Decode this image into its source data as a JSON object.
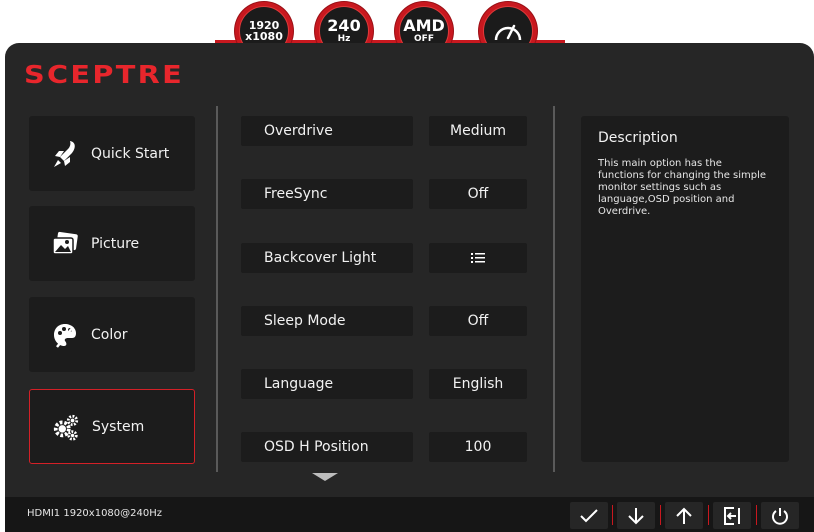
{
  "brand": {
    "logo": "SCEPTRE"
  },
  "badges": [
    {
      "line1": "1920",
      "line2": "x1080"
    },
    {
      "line1": "240",
      "line2": "Hz"
    },
    {
      "line1": "AMD",
      "line2": "OFF"
    },
    {
      "icon": "speedometer-icon"
    }
  ],
  "menu": [
    {
      "label": "Quick Start",
      "icon": "rocket-icon"
    },
    {
      "label": "Picture",
      "icon": "pictures-icon"
    },
    {
      "label": "Color",
      "icon": "palette-icon"
    },
    {
      "label": "System",
      "icon": "gears-icon",
      "active": true
    }
  ],
  "options": [
    {
      "label": "Overdrive",
      "value": "Medium"
    },
    {
      "label": "FreeSync",
      "value": "Off"
    },
    {
      "label": "Backcover Light",
      "value": "",
      "value_icon": "list-icon"
    },
    {
      "label": "Sleep Mode",
      "value": "Off"
    },
    {
      "label": "Language",
      "value": "English"
    },
    {
      "label": "OSD H Position",
      "value": "100"
    }
  ],
  "description": {
    "title": "Description",
    "body": "This main option has the functions for changing the simple monitor settings such as language,OSD position and Overdrive."
  },
  "status": {
    "text": "HDMI1 1920x1080@240Hz"
  },
  "controls": [
    {
      "icon": "check-icon"
    },
    {
      "icon": "arrow-down-icon"
    },
    {
      "icon": "arrow-up-icon"
    },
    {
      "icon": "exit-icon"
    },
    {
      "icon": "power-icon"
    }
  ],
  "colors": {
    "accent": "#d42027",
    "panel": "#262626",
    "tile": "#1c1c1c"
  }
}
